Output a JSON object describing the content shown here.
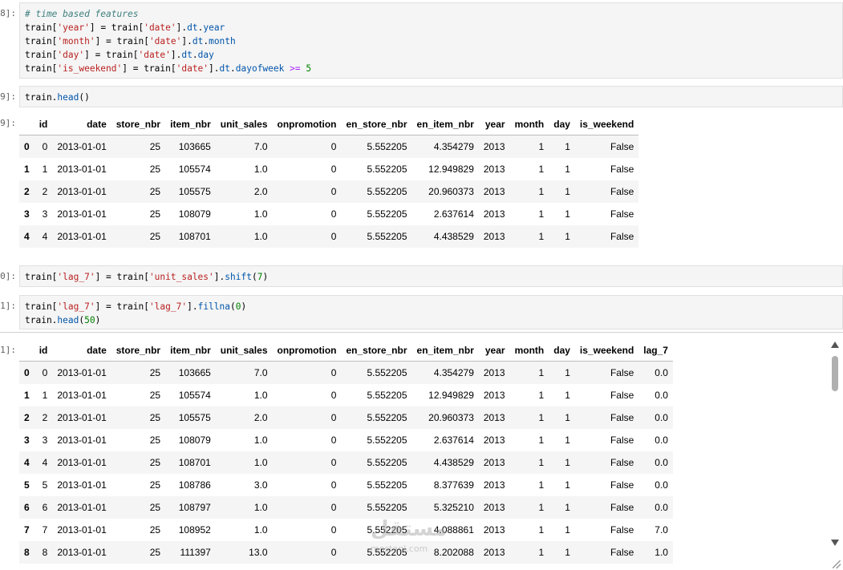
{
  "cells": {
    "c1": {
      "prompt": "8]:"
    },
    "c2": {
      "prompt": "9]:"
    },
    "c2out": {
      "prompt": "9]:"
    },
    "c3": {
      "prompt": "0]:"
    },
    "c4": {
      "prompt": "1]:"
    },
    "c4out": {
      "prompt": "1]:"
    }
  },
  "table1": {
    "columns": [
      "",
      "id",
      "date",
      "store_nbr",
      "item_nbr",
      "unit_sales",
      "onpromotion",
      "en_store_nbr",
      "en_item_nbr",
      "year",
      "month",
      "day",
      "is_weekend"
    ],
    "rows": [
      [
        "0",
        "0",
        "2013-01-01",
        "25",
        "103665",
        "7.0",
        "0",
        "5.552205",
        "4.354279",
        "2013",
        "1",
        "1",
        "False"
      ],
      [
        "1",
        "1",
        "2013-01-01",
        "25",
        "105574",
        "1.0",
        "0",
        "5.552205",
        "12.949829",
        "2013",
        "1",
        "1",
        "False"
      ],
      [
        "2",
        "2",
        "2013-01-01",
        "25",
        "105575",
        "2.0",
        "0",
        "5.552205",
        "20.960373",
        "2013",
        "1",
        "1",
        "False"
      ],
      [
        "3",
        "3",
        "2013-01-01",
        "25",
        "108079",
        "1.0",
        "0",
        "5.552205",
        "2.637614",
        "2013",
        "1",
        "1",
        "False"
      ],
      [
        "4",
        "4",
        "2013-01-01",
        "25",
        "108701",
        "1.0",
        "0",
        "5.552205",
        "4.438529",
        "2013",
        "1",
        "1",
        "False"
      ]
    ]
  },
  "table2": {
    "columns": [
      "",
      "id",
      "date",
      "store_nbr",
      "item_nbr",
      "unit_sales",
      "onpromotion",
      "en_store_nbr",
      "en_item_nbr",
      "year",
      "month",
      "day",
      "is_weekend",
      "lag_7"
    ],
    "rows": [
      [
        "0",
        "0",
        "2013-01-01",
        "25",
        "103665",
        "7.0",
        "0",
        "5.552205",
        "4.354279",
        "2013",
        "1",
        "1",
        "False",
        "0.0"
      ],
      [
        "1",
        "1",
        "2013-01-01",
        "25",
        "105574",
        "1.0",
        "0",
        "5.552205",
        "12.949829",
        "2013",
        "1",
        "1",
        "False",
        "0.0"
      ],
      [
        "2",
        "2",
        "2013-01-01",
        "25",
        "105575",
        "2.0",
        "0",
        "5.552205",
        "20.960373",
        "2013",
        "1",
        "1",
        "False",
        "0.0"
      ],
      [
        "3",
        "3",
        "2013-01-01",
        "25",
        "108079",
        "1.0",
        "0",
        "5.552205",
        "2.637614",
        "2013",
        "1",
        "1",
        "False",
        "0.0"
      ],
      [
        "4",
        "4",
        "2013-01-01",
        "25",
        "108701",
        "1.0",
        "0",
        "5.552205",
        "4.438529",
        "2013",
        "1",
        "1",
        "False",
        "0.0"
      ],
      [
        "5",
        "5",
        "2013-01-01",
        "25",
        "108786",
        "3.0",
        "0",
        "5.552205",
        "8.377639",
        "2013",
        "1",
        "1",
        "False",
        "0.0"
      ],
      [
        "6",
        "6",
        "2013-01-01",
        "25",
        "108797",
        "1.0",
        "0",
        "5.552205",
        "5.325210",
        "2013",
        "1",
        "1",
        "False",
        "0.0"
      ],
      [
        "7",
        "7",
        "2013-01-01",
        "25",
        "108952",
        "1.0",
        "0",
        "5.552205",
        "4.088861",
        "2013",
        "1",
        "1",
        "False",
        "7.0"
      ],
      [
        "8",
        "8",
        "2013-01-01",
        "25",
        "111397",
        "13.0",
        "0",
        "5.552205",
        "8.202088",
        "2013",
        "1",
        "1",
        "False",
        "1.0"
      ]
    ]
  },
  "watermark": {
    "arabic": "مستقل",
    "latin": "mostaql.com"
  },
  "colors": {
    "code_bg": "#f5f5f5",
    "string": "#ba2121",
    "attribute": "#0055aa",
    "comment": "#408080",
    "number": "#008000"
  }
}
